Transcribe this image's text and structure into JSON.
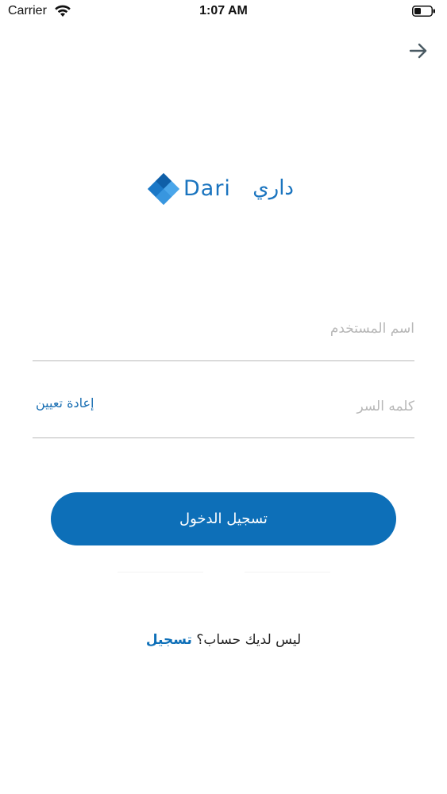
{
  "status_bar": {
    "carrier": "Carrier",
    "time": "1:07 AM",
    "wifi_icon": "wifi-icon",
    "battery_icon": "battery-icon"
  },
  "nav": {
    "arrow_icon": "arrow-right-icon"
  },
  "logo": {
    "latin": "Dari",
    "arabic": "داري",
    "mark_icon": "diamond-logo-icon"
  },
  "form": {
    "username_placeholder": "اسم المستخدم",
    "username_value": "",
    "password_placeholder": "كلمه السر",
    "password_value": "",
    "reset_label": "إعادة تعيين"
  },
  "login_button": {
    "label": "تسجيل الدخول"
  },
  "signup": {
    "prompt": "ليس لديك حساب؟",
    "link_label": "تسجيل"
  },
  "colors": {
    "brand_blue": "#0d6fb8",
    "logo_blue": "#1a74bf",
    "field_border": "#b9b9b9",
    "placeholder": "#b7b7b7"
  }
}
